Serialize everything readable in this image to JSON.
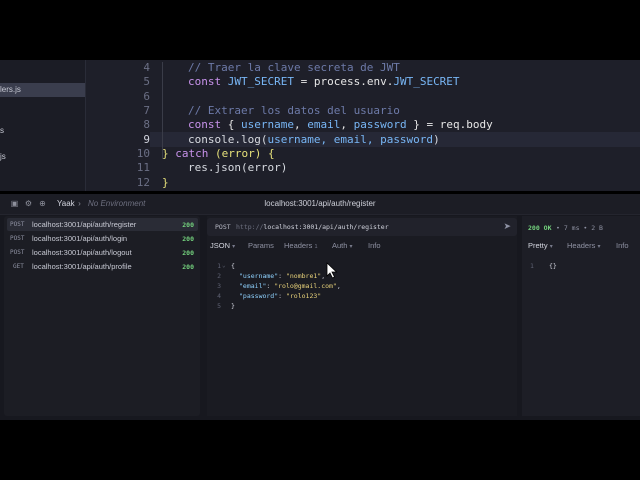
{
  "editor": {
    "sidebar_files": [
      "lers.js",
      "s",
      "js"
    ],
    "line_numbers": [
      "4",
      "5",
      "6",
      "7",
      "8",
      "9",
      "10",
      "11",
      "12"
    ],
    "current_line": "9",
    "code": {
      "l4": "// Traer la clave secreta de JWT",
      "l5_kw": "const",
      "l5_var": "JWT_SECRET",
      "l5_rest": " = process.env.",
      "l5_env": "JWT_SECRET",
      "l7": "// Extraer los datos del usuario",
      "l8_kw": "const",
      "l8_open": " { ",
      "l8_a": "username",
      "l8_sep1": ", ",
      "l8_b": "email",
      "l8_sep2": ", ",
      "l8_c": "password",
      "l8_close": " } = req.body",
      "l9_fn": "console.log(",
      "l9_args": "username, email, password",
      "l9_close": ")",
      "l10_close": "} ",
      "l10_kw": "catch",
      "l10_arg": " (error) {",
      "l11": "res.json(error)",
      "l12": "}"
    }
  },
  "app": {
    "name": "Yaak",
    "environment": "No Environment",
    "window_title": "localhost:3001/api/auth/register"
  },
  "requests": [
    {
      "method": "POST",
      "url": "localhost:3001/api/auth/register",
      "status": "200"
    },
    {
      "method": "POST",
      "url": "localhost:3001/api/auth/login",
      "status": "200"
    },
    {
      "method": "POST",
      "url": "localhost:3001/api/auth/logout",
      "status": "200"
    },
    {
      "method": "GET",
      "url": "localhost:3001/api/auth/profile",
      "status": "200"
    }
  ],
  "request": {
    "method": "POST",
    "url_scheme": "http://",
    "url_rest": "localhost:3001/api/auth/register",
    "tabs": {
      "body": "JSON",
      "params": "Params",
      "headers": "Headers",
      "headers_count": "1",
      "auth": "Auth",
      "info": "Info"
    },
    "body_lines": [
      "1",
      "2",
      "3",
      "4",
      "5"
    ],
    "body": {
      "open": "{",
      "k1": "\"username\"",
      "v1": "\"nombre1\"",
      "k2": "\"email\"",
      "v2": "\"rolo@gmail.com\"",
      "k3": "\"password\"",
      "v3": "\"rolo123\"",
      "close": "}"
    }
  },
  "response": {
    "status": "200 OK",
    "meta": "• 7 ms • 2 B",
    "tabs": {
      "pretty": "Pretty",
      "headers": "Headers",
      "info": "Info"
    },
    "line": "1",
    "body": "{}"
  },
  "colors": {
    "status_ok": "#73d17d",
    "accent_comment": "#6d7aa8",
    "keyword": "#c792ea"
  }
}
